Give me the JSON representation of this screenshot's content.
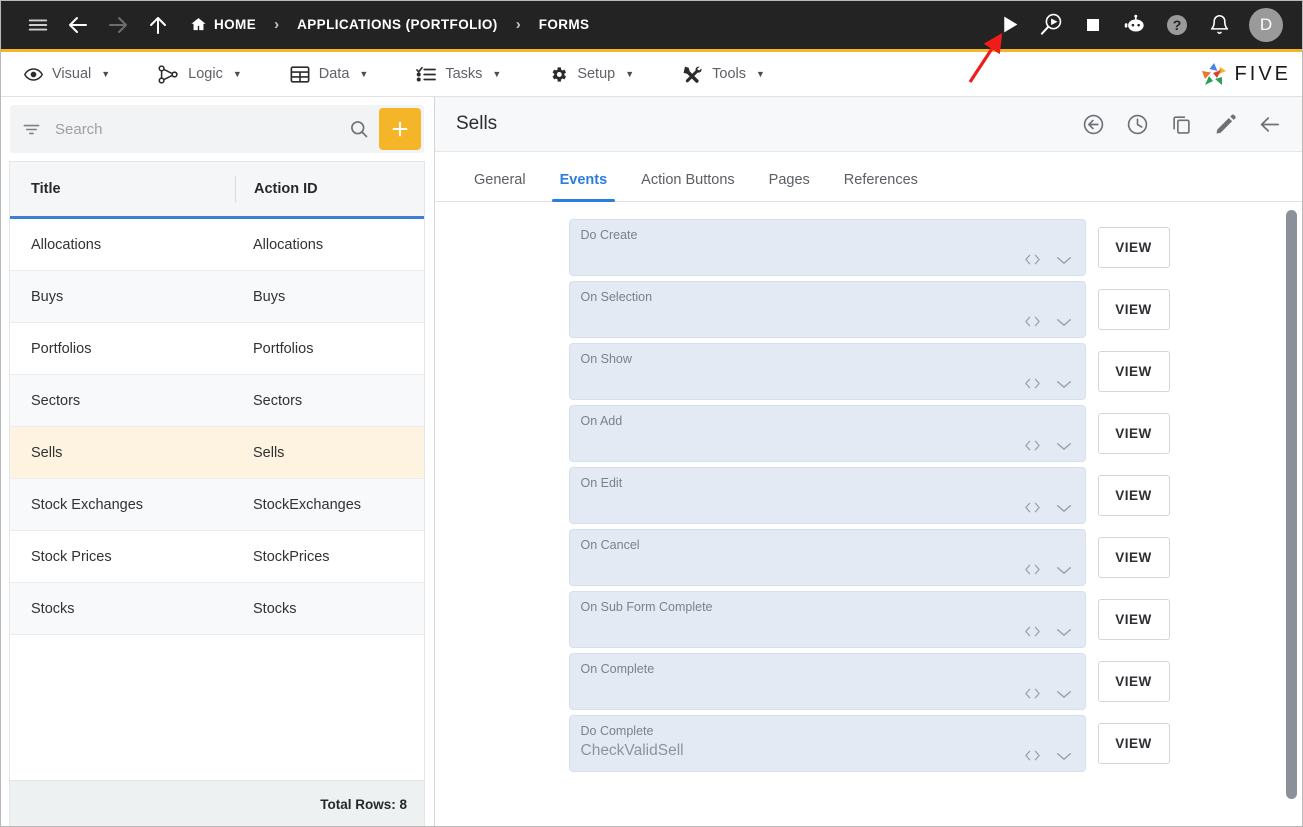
{
  "topbar": {
    "nav_icons": [
      "menu-icon",
      "back-arrow-icon",
      "forward-arrow-icon",
      "up-arrow-icon"
    ],
    "breadcrumbs": [
      {
        "label": "HOME",
        "icon": "home-icon"
      },
      {
        "label": "APPLICATIONS (PORTFOLIO)",
        "icon": ""
      },
      {
        "label": "FORMS",
        "icon": ""
      }
    ],
    "separator": "›",
    "right_icons": [
      {
        "name": "run-play-icon",
        "title": "Run"
      },
      {
        "name": "debug-search-play-icon",
        "title": "Debug"
      },
      {
        "name": "stop-square-icon",
        "title": "Stop"
      },
      {
        "name": "chatbot-icon",
        "title": "Assistant"
      },
      {
        "name": "help-question-icon",
        "title": "Help"
      },
      {
        "name": "notification-bell-icon",
        "title": "Notifications"
      }
    ],
    "avatar_initial": "D",
    "accent_color": "#f5b528",
    "bar_color": "#232323"
  },
  "menubar": {
    "items": [
      {
        "label": "Visual",
        "icon": "eye-icon",
        "caret": "▼"
      },
      {
        "label": "Logic",
        "icon": "logic-nodes-icon",
        "caret": "▼"
      },
      {
        "label": "Data",
        "icon": "table-grid-icon",
        "caret": "▼"
      },
      {
        "label": "Tasks",
        "icon": "checklist-icon",
        "caret": "▼"
      },
      {
        "label": "Setup",
        "icon": "gear-icon",
        "caret": "▼"
      },
      {
        "label": "Tools",
        "icon": "wrench-screwdriver-icon",
        "caret": "▼"
      }
    ],
    "brand": {
      "text": "FIVE",
      "logo": "five-pinwheel-logo"
    }
  },
  "sidebar": {
    "search": {
      "placeholder": "Search",
      "value": ""
    },
    "filter_icon": "filter-icon",
    "search_icon": "search-icon",
    "add_button": {
      "icon": "plus-icon",
      "color": "#f5b528"
    },
    "columns": [
      "Title",
      "Action ID"
    ],
    "rows": [
      {
        "title": "Allocations",
        "action_id": "Allocations",
        "selected": false
      },
      {
        "title": "Buys",
        "action_id": "Buys",
        "selected": false
      },
      {
        "title": "Portfolios",
        "action_id": "Portfolios",
        "selected": false
      },
      {
        "title": "Sectors",
        "action_id": "Sectors",
        "selected": false
      },
      {
        "title": "Sells",
        "action_id": "Sells",
        "selected": true
      },
      {
        "title": "Stock Exchanges",
        "action_id": "StockExchanges",
        "selected": false
      },
      {
        "title": "Stock Prices",
        "action_id": "StockPrices",
        "selected": false
      },
      {
        "title": "Stocks",
        "action_id": "Stocks",
        "selected": false
      }
    ],
    "footer": "Total Rows: 8"
  },
  "detail": {
    "title": "Sells",
    "header_actions": [
      {
        "name": "revert-icon",
        "label": "Revert"
      },
      {
        "name": "history-clock-icon",
        "label": "History"
      },
      {
        "name": "duplicate-icon",
        "label": "Duplicate"
      },
      {
        "name": "edit-pencil-icon",
        "label": "Edit"
      },
      {
        "name": "back-arrow-icon",
        "label": "Back"
      }
    ],
    "tabs": [
      {
        "label": "General",
        "active": false
      },
      {
        "label": "Events",
        "active": true
      },
      {
        "label": "Action Buttons",
        "active": false
      },
      {
        "label": "Pages",
        "active": false
      },
      {
        "label": "References",
        "active": false
      }
    ],
    "view_button_label": "VIEW",
    "events": [
      {
        "label": "Do Create",
        "value": ""
      },
      {
        "label": "On Selection",
        "value": ""
      },
      {
        "label": "On Show",
        "value": ""
      },
      {
        "label": "On Add",
        "value": ""
      },
      {
        "label": "On Edit",
        "value": ""
      },
      {
        "label": "On Cancel",
        "value": ""
      },
      {
        "label": "On Sub Form Complete",
        "value": ""
      },
      {
        "label": "On Complete",
        "value": ""
      },
      {
        "label": "Do Complete",
        "value": "CheckValidSell"
      }
    ],
    "field_icons": {
      "code": "code-brackets-icon",
      "expand": "chevron-down-icon"
    }
  },
  "annotation": {
    "type": "red-arrow",
    "points_to": "run-play-icon",
    "color": "#ef1c1c"
  }
}
